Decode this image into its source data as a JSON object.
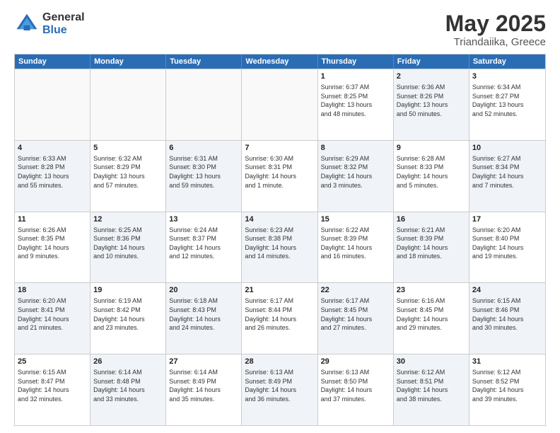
{
  "logo": {
    "general": "General",
    "blue": "Blue"
  },
  "title": "May 2025",
  "subtitle": "Triandaiika, Greece",
  "header_days": [
    "Sunday",
    "Monday",
    "Tuesday",
    "Wednesday",
    "Thursday",
    "Friday",
    "Saturday"
  ],
  "rows": [
    [
      {
        "day": "",
        "text": "",
        "empty": true
      },
      {
        "day": "",
        "text": "",
        "empty": true
      },
      {
        "day": "",
        "text": "",
        "empty": true
      },
      {
        "day": "",
        "text": "",
        "empty": true
      },
      {
        "day": "1",
        "text": "Sunrise: 6:37 AM\nSunset: 8:25 PM\nDaylight: 13 hours\nand 48 minutes.",
        "shaded": false
      },
      {
        "day": "2",
        "text": "Sunrise: 6:36 AM\nSunset: 8:26 PM\nDaylight: 13 hours\nand 50 minutes.",
        "shaded": true
      },
      {
        "day": "3",
        "text": "Sunrise: 6:34 AM\nSunset: 8:27 PM\nDaylight: 13 hours\nand 52 minutes.",
        "shaded": false
      }
    ],
    [
      {
        "day": "4",
        "text": "Sunrise: 6:33 AM\nSunset: 8:28 PM\nDaylight: 13 hours\nand 55 minutes.",
        "shaded": true
      },
      {
        "day": "5",
        "text": "Sunrise: 6:32 AM\nSunset: 8:29 PM\nDaylight: 13 hours\nand 57 minutes.",
        "shaded": false
      },
      {
        "day": "6",
        "text": "Sunrise: 6:31 AM\nSunset: 8:30 PM\nDaylight: 13 hours\nand 59 minutes.",
        "shaded": true
      },
      {
        "day": "7",
        "text": "Sunrise: 6:30 AM\nSunset: 8:31 PM\nDaylight: 14 hours\nand 1 minute.",
        "shaded": false
      },
      {
        "day": "8",
        "text": "Sunrise: 6:29 AM\nSunset: 8:32 PM\nDaylight: 14 hours\nand 3 minutes.",
        "shaded": true
      },
      {
        "day": "9",
        "text": "Sunrise: 6:28 AM\nSunset: 8:33 PM\nDaylight: 14 hours\nand 5 minutes.",
        "shaded": false
      },
      {
        "day": "10",
        "text": "Sunrise: 6:27 AM\nSunset: 8:34 PM\nDaylight: 14 hours\nand 7 minutes.",
        "shaded": true
      }
    ],
    [
      {
        "day": "11",
        "text": "Sunrise: 6:26 AM\nSunset: 8:35 PM\nDaylight: 14 hours\nand 9 minutes.",
        "shaded": false
      },
      {
        "day": "12",
        "text": "Sunrise: 6:25 AM\nSunset: 8:36 PM\nDaylight: 14 hours\nand 10 minutes.",
        "shaded": true
      },
      {
        "day": "13",
        "text": "Sunrise: 6:24 AM\nSunset: 8:37 PM\nDaylight: 14 hours\nand 12 minutes.",
        "shaded": false
      },
      {
        "day": "14",
        "text": "Sunrise: 6:23 AM\nSunset: 8:38 PM\nDaylight: 14 hours\nand 14 minutes.",
        "shaded": true
      },
      {
        "day": "15",
        "text": "Sunrise: 6:22 AM\nSunset: 8:39 PM\nDaylight: 14 hours\nand 16 minutes.",
        "shaded": false
      },
      {
        "day": "16",
        "text": "Sunrise: 6:21 AM\nSunset: 8:39 PM\nDaylight: 14 hours\nand 18 minutes.",
        "shaded": true
      },
      {
        "day": "17",
        "text": "Sunrise: 6:20 AM\nSunset: 8:40 PM\nDaylight: 14 hours\nand 19 minutes.",
        "shaded": false
      }
    ],
    [
      {
        "day": "18",
        "text": "Sunrise: 6:20 AM\nSunset: 8:41 PM\nDaylight: 14 hours\nand 21 minutes.",
        "shaded": true
      },
      {
        "day": "19",
        "text": "Sunrise: 6:19 AM\nSunset: 8:42 PM\nDaylight: 14 hours\nand 23 minutes.",
        "shaded": false
      },
      {
        "day": "20",
        "text": "Sunrise: 6:18 AM\nSunset: 8:43 PM\nDaylight: 14 hours\nand 24 minutes.",
        "shaded": true
      },
      {
        "day": "21",
        "text": "Sunrise: 6:17 AM\nSunset: 8:44 PM\nDaylight: 14 hours\nand 26 minutes.",
        "shaded": false
      },
      {
        "day": "22",
        "text": "Sunrise: 6:17 AM\nSunset: 8:45 PM\nDaylight: 14 hours\nand 27 minutes.",
        "shaded": true
      },
      {
        "day": "23",
        "text": "Sunrise: 6:16 AM\nSunset: 8:45 PM\nDaylight: 14 hours\nand 29 minutes.",
        "shaded": false
      },
      {
        "day": "24",
        "text": "Sunrise: 6:15 AM\nSunset: 8:46 PM\nDaylight: 14 hours\nand 30 minutes.",
        "shaded": true
      }
    ],
    [
      {
        "day": "25",
        "text": "Sunrise: 6:15 AM\nSunset: 8:47 PM\nDaylight: 14 hours\nand 32 minutes.",
        "shaded": false
      },
      {
        "day": "26",
        "text": "Sunrise: 6:14 AM\nSunset: 8:48 PM\nDaylight: 14 hours\nand 33 minutes.",
        "shaded": true
      },
      {
        "day": "27",
        "text": "Sunrise: 6:14 AM\nSunset: 8:49 PM\nDaylight: 14 hours\nand 35 minutes.",
        "shaded": false
      },
      {
        "day": "28",
        "text": "Sunrise: 6:13 AM\nSunset: 8:49 PM\nDaylight: 14 hours\nand 36 minutes.",
        "shaded": true
      },
      {
        "day": "29",
        "text": "Sunrise: 6:13 AM\nSunset: 8:50 PM\nDaylight: 14 hours\nand 37 minutes.",
        "shaded": false
      },
      {
        "day": "30",
        "text": "Sunrise: 6:12 AM\nSunset: 8:51 PM\nDaylight: 14 hours\nand 38 minutes.",
        "shaded": true
      },
      {
        "day": "31",
        "text": "Sunrise: 6:12 AM\nSunset: 8:52 PM\nDaylight: 14 hours\nand 39 minutes.",
        "shaded": false
      }
    ]
  ]
}
